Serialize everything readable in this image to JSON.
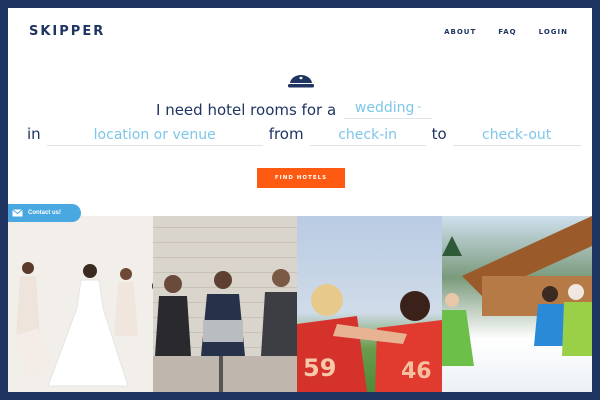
{
  "header": {
    "logo": "SKIPPER",
    "nav": [
      {
        "label": "ABOUT"
      },
      {
        "label": "FAQ"
      },
      {
        "label": "LOGIN"
      }
    ]
  },
  "hero": {
    "sentence_start": "I need hotel rooms for a",
    "occasion_value": "wedding",
    "occasion_caret": "-",
    "in_label": "in",
    "location_placeholder": "location or venue",
    "from_label": "from",
    "checkin_placeholder": "check-in",
    "to_label": "to",
    "checkout_placeholder": "check-out",
    "cta": "FIND HOTELS"
  },
  "contact": {
    "label": "Contact us!"
  },
  "photos": [
    {
      "subject": "wedding"
    },
    {
      "subject": "business"
    },
    {
      "subject": "sports"
    },
    {
      "subject": "ski trip"
    }
  ],
  "colors": {
    "brand_navy": "#1f3461",
    "accent_orange": "#ff5a11",
    "field_blue": "#7ec6e8",
    "contact_blue": "#4aa8e0"
  }
}
